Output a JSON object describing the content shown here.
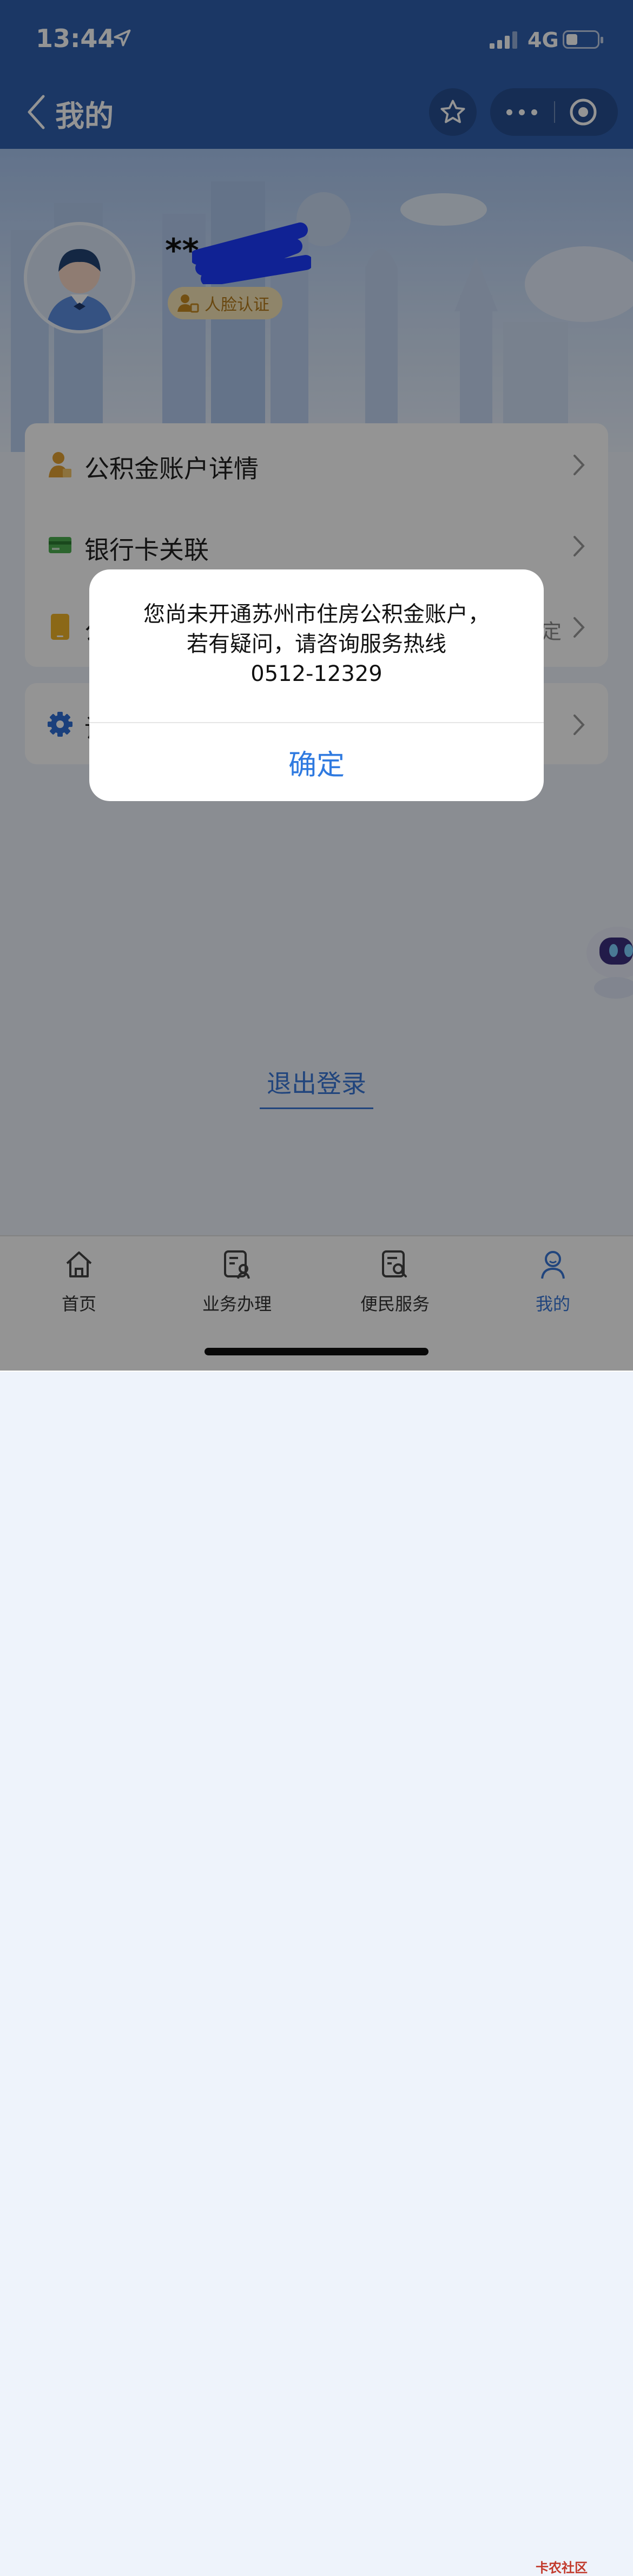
{
  "status_bar": {
    "time": "13:44",
    "network": "4G",
    "battery_level": 0.35
  },
  "nav": {
    "back_icon": "chevron-left-icon",
    "title": "我的",
    "favorite_icon": "star-icon",
    "more_icon": "more-dots-icon",
    "close_icon": "target-circle-icon"
  },
  "profile": {
    "name_masked": "**",
    "face_auth_label": "人脸认证"
  },
  "menu": [
    {
      "label": "公积金账户详情",
      "value": "",
      "icon": "user-id-icon"
    },
    {
      "label": "银行卡关联",
      "value": "",
      "icon": "bank-card-icon"
    },
    {
      "label": "公",
      "value": "定",
      "icon": "phone-icon"
    }
  ],
  "settings": {
    "label": "设",
    "icon": "gear-icon"
  },
  "logout_label": "退出登录",
  "tabs": [
    {
      "label": "首页",
      "icon": "home-icon",
      "active": false
    },
    {
      "label": "业务办理",
      "icon": "business-doc-icon",
      "active": false
    },
    {
      "label": "便民服务",
      "icon": "service-search-icon",
      "active": false
    },
    {
      "label": "我的",
      "icon": "user-icon",
      "active": true
    }
  ],
  "watermark": "卡农社区",
  "dialog": {
    "message": "您尚未开通苏州市住房公积金账户，\n若有疑问，请咨询服务热线\n0512-12329",
    "confirm_label": "确定"
  },
  "colors": {
    "brand_blue": "#2f5fae",
    "link_blue": "#3a78d8",
    "badge_gold": "#b57b1a"
  }
}
